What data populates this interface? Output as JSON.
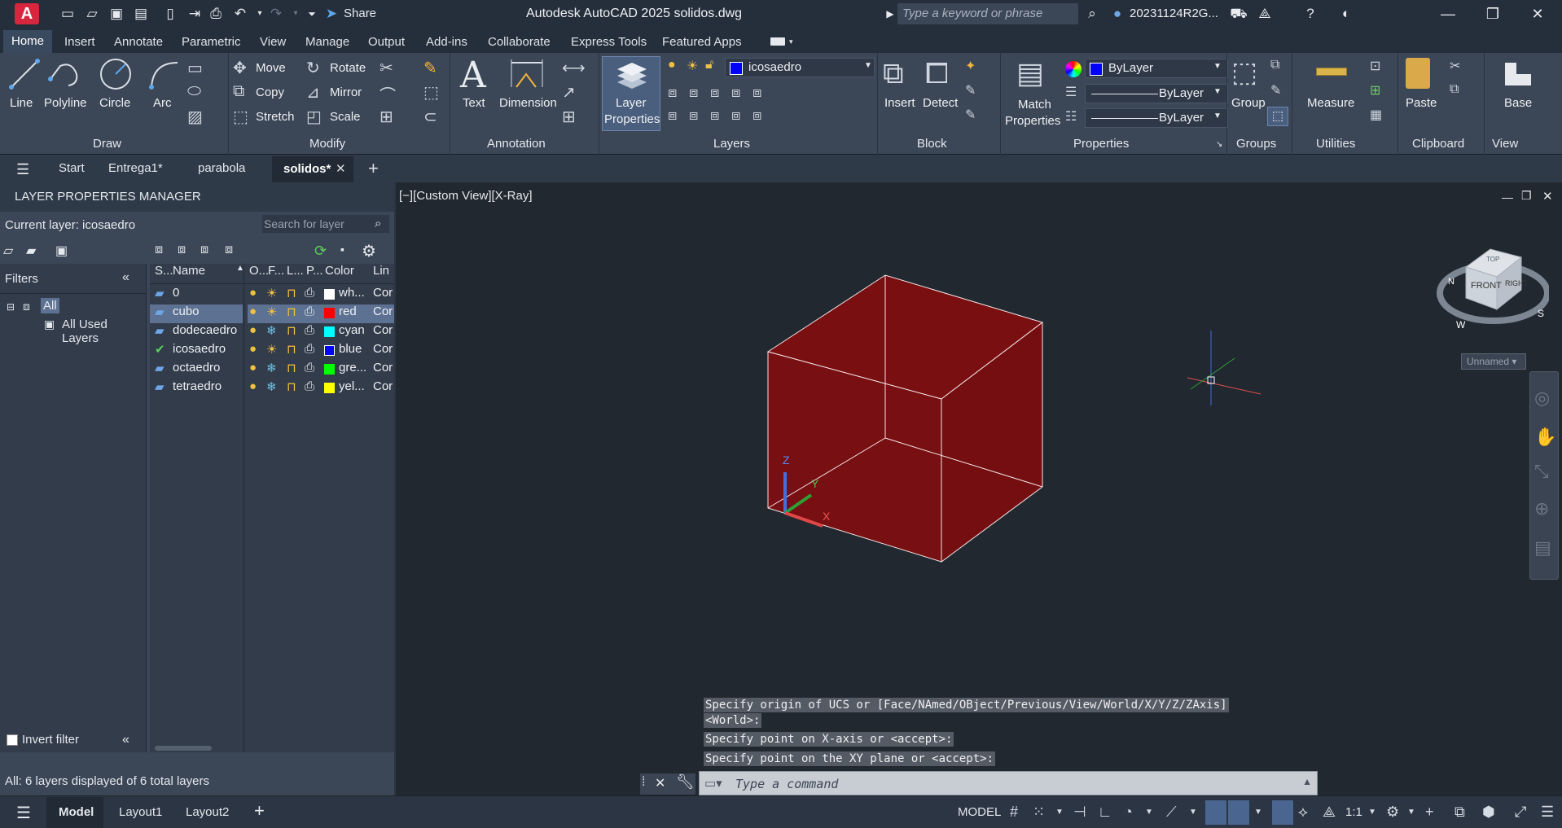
{
  "titlebar": {
    "app_letter": "A",
    "share_label": "Share",
    "title": "Autodesk AutoCAD 2025    solidos.dwg",
    "search_placeholder": "Type a keyword or phrase",
    "user": "20231124R2G..."
  },
  "ribbon_tabs": [
    "Home",
    "Insert",
    "Annotate",
    "Parametric",
    "View",
    "Manage",
    "Output",
    "Add-ins",
    "Collaborate",
    "Express Tools",
    "Featured Apps"
  ],
  "ribbon": {
    "draw": {
      "line": "Line",
      "polyline": "Polyline",
      "circle": "Circle",
      "arc": "Arc",
      "panel": "Draw"
    },
    "modify": {
      "move": "Move",
      "rotate": "Rotate",
      "copy": "Copy",
      "mirror": "Mirror",
      "stretch": "Stretch",
      "scale": "Scale",
      "panel": "Modify"
    },
    "annotation": {
      "text": "Text",
      "dimension": "Dimension",
      "panel": "Annotation"
    },
    "layers": {
      "layer_properties_1": "Layer",
      "layer_properties_2": "Properties",
      "current": "icosaedro",
      "panel": "Layers"
    },
    "block": {
      "insert": "Insert",
      "detect": "Detect",
      "panel": "Block"
    },
    "properties": {
      "match_1": "Match",
      "match_2": "Properties",
      "color": "ByLayer",
      "linetype": "ByLayer",
      "lineweight": "ByLayer",
      "panel": "Properties"
    },
    "groups": {
      "group": "Group",
      "panel": "Groups"
    },
    "utilities": {
      "measure": "Measure",
      "panel": "Utilities"
    },
    "clipboard": {
      "paste": "Paste",
      "panel": "Clipboard"
    },
    "view": {
      "base": "Base",
      "panel": "View"
    }
  },
  "doc_tabs": {
    "start": "Start",
    "entrega": "Entrega1*",
    "parabola": "parabola",
    "solidos": "solidos*"
  },
  "layer_manager": {
    "title": "LAYER PROPERTIES MANAGER",
    "current_layer": "Current layer: icosaedro",
    "search_placeholder": "Search for layer",
    "filters_label": "Filters",
    "filter_all": "All",
    "filter_used": "All Used Layers",
    "invert_filter": "Invert filter",
    "status_text": "All: 6 layers displayed of 6 total layers",
    "columns": {
      "s": "S...",
      "name": "Name",
      "o": "O...",
      "f": "F...",
      "l": "L...",
      "p": "P...",
      "color": "Color",
      "lin": "Lin"
    },
    "layers": [
      {
        "name": "0",
        "color_name": "wh...",
        "color": "#ffffff",
        "lin": "Cor"
      },
      {
        "name": "cubo",
        "color_name": "red",
        "color": "#ff0000",
        "lin": "Cor"
      },
      {
        "name": "dodecaedro",
        "color_name": "cyan",
        "color": "#00ffff",
        "lin": "Cor"
      },
      {
        "name": "icosaedro",
        "color_name": "blue",
        "color": "#0000ff",
        "lin": "Cor"
      },
      {
        "name": "octaedro",
        "color_name": "gre...",
        "color": "#00ff00",
        "lin": "Cor"
      },
      {
        "name": "tetraedro",
        "color_name": "yel...",
        "color": "#ffff00",
        "lin": "Cor"
      }
    ]
  },
  "viewport": {
    "label": "[−][Custom View][X-Ray]",
    "viewcube_top": "TOP",
    "viewcube_front": "FRONT",
    "viewcube_right": "RIGHT",
    "compass_n": "N",
    "compass_s": "S",
    "compass_w": "W",
    "ucs_name": "Unnamed",
    "axis_z": "Z",
    "axis_y": "Y",
    "axis_x": "X"
  },
  "command": {
    "history_1": "Specify origin of UCS or [Face/NAmed/OBject/Previous/View/World/X/Y/Z/ZAxis]",
    "history_2": "<World>:",
    "history_3": "Specify point on X-axis or <accept>:",
    "history_4": "Specify point on the XY plane or <accept>:",
    "placeholder": "Type a command"
  },
  "status": {
    "model_tab": "Model",
    "layout1": "Layout1",
    "layout2": "Layout2",
    "model_label": "MODEL",
    "scale": "1:1"
  }
}
